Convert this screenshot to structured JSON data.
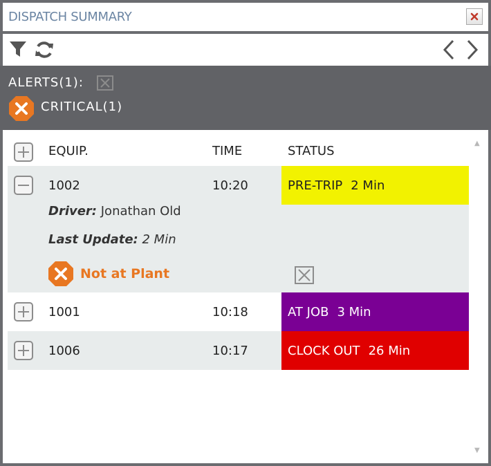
{
  "window": {
    "title": "DISPATCH SUMMARY"
  },
  "toolbar": {
    "filter_icon": "filter-icon",
    "refresh_icon": "refresh-icon",
    "prev_icon": "chevron-left-icon",
    "next_icon": "chevron-right-icon"
  },
  "alerts": {
    "label": "ALERTS(1):",
    "critical_label": "CRITICAL(1)"
  },
  "table": {
    "headers": {
      "equip": "EQUIP.",
      "time": "TIME",
      "status": "STATUS"
    },
    "rows": [
      {
        "equip": "1002",
        "time": "10:20",
        "status": "PRE-TRIP",
        "duration": "2 Min",
        "status_color": "#f2f200",
        "status_text_color": "#222222",
        "expanded": true,
        "driver_label": "Driver:",
        "driver": "Jonathan Old",
        "update_label": "Last Update:",
        "update": "2 Min",
        "alert": "Not at Plant"
      },
      {
        "equip": "1001",
        "time": "10:18",
        "status": "AT JOB",
        "duration": "3 Min",
        "status_color": "#7a0094",
        "status_text_color": "#ffffff",
        "expanded": false
      },
      {
        "equip": "1006",
        "time": "10:17",
        "status": "CLOCK OUT",
        "duration": "26 Min",
        "status_color": "#e00000",
        "status_text_color": "#ffffff",
        "expanded": false
      }
    ]
  },
  "colors": {
    "alert_orange": "#e87722",
    "header_gray": "#616266",
    "title_blue": "#6b85a3"
  }
}
